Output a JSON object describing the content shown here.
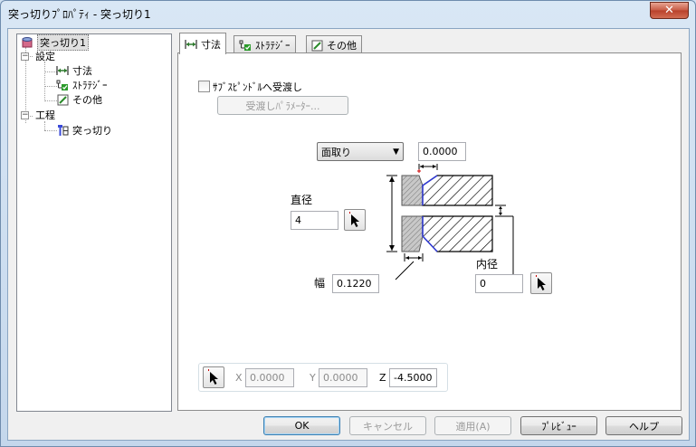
{
  "window": {
    "title": "突っ切りﾌﾟﾛﾊﾟﾃｨ - 突っ切り1",
    "close_glyph": "✕"
  },
  "tree": {
    "root": {
      "label": "突っ切り1",
      "icon": "cylinder-icon"
    },
    "settings": {
      "label": "設定",
      "expander": "−"
    },
    "settings_children": [
      {
        "label": "寸法",
        "icon": "dimension-icon"
      },
      {
        "label": "ｽﾄﾗﾃｼﾞｰ",
        "icon": "strategy-icon"
      },
      {
        "label": "その他",
        "icon": "edit-note-icon"
      }
    ],
    "process": {
      "label": "工程",
      "expander": "−"
    },
    "process_children": [
      {
        "label": "突っ切り",
        "icon": "parting-tool-icon"
      }
    ]
  },
  "tabs": [
    {
      "label": "寸法",
      "active": true
    },
    {
      "label": "ｽﾄﾗﾃｼﾞｰ",
      "active": false
    },
    {
      "label": "その他",
      "active": false
    }
  ],
  "dimension_tab": {
    "sub_spindle_checkbox": {
      "label": "ｻﾌﾞｽﾋﾟﾝﾄﾞﾙへ受渡し",
      "checked": false
    },
    "transfer_params_button": "受渡しﾊﾟﾗﾒｰﾀｰ...",
    "edge_type": {
      "selected": "面取り"
    },
    "chamfer_value": "0.0000",
    "diameter": {
      "label": "直径",
      "value": "4"
    },
    "width": {
      "label": "幅",
      "value": "0.1220"
    },
    "inner_diameter": {
      "label": "内径",
      "value": "0"
    },
    "position": {
      "x_label": "X",
      "x_value": "0.0000",
      "y_label": "Y",
      "y_value": "0.0000",
      "z_label": "Z",
      "z_value": "-4.5000"
    }
  },
  "buttons": {
    "ok": "OK",
    "cancel": "キャンセル",
    "apply": "適用(A)",
    "preview": "ﾌﾟﾚﾋﾞｭｰ",
    "help": "ヘルプ"
  },
  "colors": {
    "accent_red": "#cc0000",
    "diagram_blue": "#2e38d6",
    "check_green": "#2a9a2a"
  }
}
